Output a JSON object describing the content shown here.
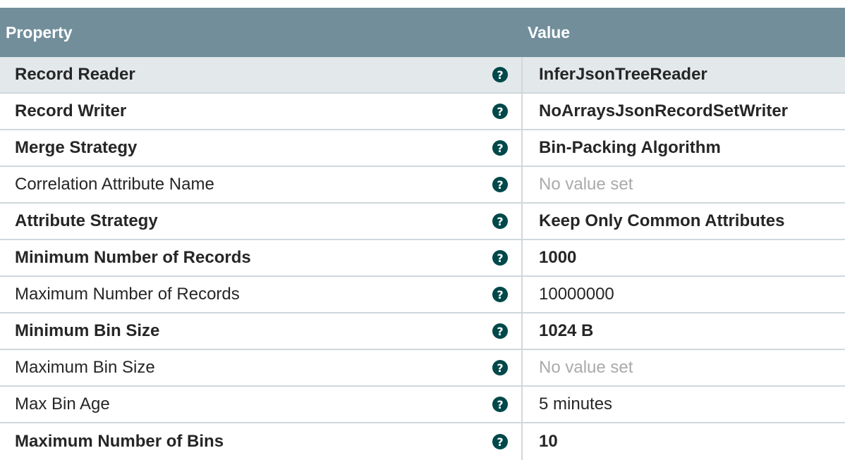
{
  "header": {
    "property_label": "Property",
    "value_label": "Value"
  },
  "help_icon_glyph": "?",
  "rows": [
    {
      "name": "Record Reader",
      "value": "InferJsonTreeReader",
      "required": true,
      "unset": false
    },
    {
      "name": "Record Writer",
      "value": "NoArraysJsonRecordSetWriter",
      "required": true,
      "unset": false
    },
    {
      "name": "Merge Strategy",
      "value": "Bin-Packing Algorithm",
      "required": true,
      "unset": false
    },
    {
      "name": "Correlation Attribute Name",
      "value": "No value set",
      "required": false,
      "unset": true
    },
    {
      "name": "Attribute Strategy",
      "value": "Keep Only Common Attributes",
      "required": true,
      "unset": false
    },
    {
      "name": "Minimum Number of Records",
      "value": "1000",
      "required": true,
      "unset": false
    },
    {
      "name": "Maximum Number of Records",
      "value": "10000000",
      "required": false,
      "unset": false
    },
    {
      "name": "Minimum Bin Size",
      "value": "1024 B",
      "required": true,
      "unset": false
    },
    {
      "name": "Maximum Bin Size",
      "value": "No value set",
      "required": false,
      "unset": true
    },
    {
      "name": "Max Bin Age",
      "value": "5 minutes",
      "required": false,
      "unset": false
    },
    {
      "name": "Maximum Number of Bins",
      "value": "10",
      "required": true,
      "unset": false
    }
  ],
  "colors": {
    "header_bg": "#728e9b",
    "selected_row_bg": "#e3e8eb",
    "help_icon_bg": "#004849",
    "unset_value": "#aaaaaa"
  }
}
